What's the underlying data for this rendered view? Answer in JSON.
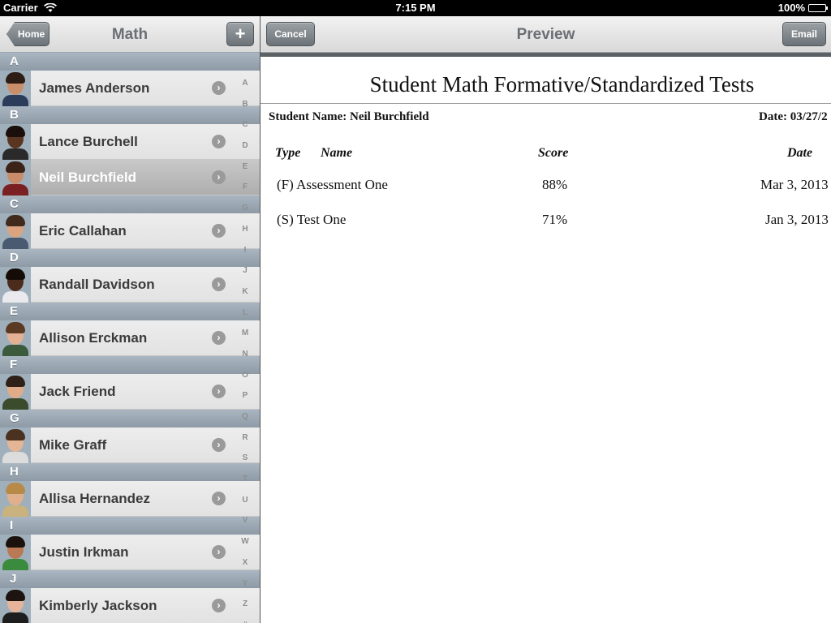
{
  "status_bar": {
    "carrier": "Carrier",
    "time": "7:15 PM",
    "battery": "100%"
  },
  "master": {
    "back_label": "Home",
    "title": "Math",
    "add_label": "+",
    "sections": [
      {
        "letter": "A",
        "students": [
          {
            "name": "James Anderson",
            "skin": "#c98f6a",
            "hair": "#2d1d14",
            "shirt": "#2b3d5a"
          }
        ]
      },
      {
        "letter": "B",
        "students": [
          {
            "name": "Lance Burchell",
            "skin": "#5a3522",
            "hair": "#1a0f0a",
            "shirt": "#2a2a2a"
          },
          {
            "name": "Neil Burchfield",
            "skin": "#c98c6a",
            "hair": "#3b2417",
            "shirt": "#7a1f22",
            "selected": true
          }
        ]
      },
      {
        "letter": "C",
        "students": [
          {
            "name": "Eric Callahan",
            "skin": "#d9a47f",
            "hair": "#3f2a1c",
            "shirt": "#4a5a70"
          }
        ]
      },
      {
        "letter": "D",
        "students": [
          {
            "name": "Randall Davidson",
            "skin": "#4b2c1c",
            "hair": "#160c07",
            "shirt": "#e9e9ee"
          }
        ]
      },
      {
        "letter": "E",
        "students": [
          {
            "name": "Allison Erckman",
            "skin": "#e3b193",
            "hair": "#5a3a23",
            "shirt": "#3c5a3c"
          }
        ]
      },
      {
        "letter": "F",
        "students": [
          {
            "name": "Jack Friend",
            "skin": "#e0ab89",
            "hair": "#2f2118",
            "shirt": "#3a4c2c"
          }
        ]
      },
      {
        "letter": "G",
        "students": [
          {
            "name": "Mike Graff",
            "skin": "#e4b696",
            "hair": "#4b3220",
            "shirt": "#dcdcdc"
          }
        ]
      },
      {
        "letter": "H",
        "students": [
          {
            "name": "Allisa Hernandez",
            "skin": "#e0b08d",
            "hair": "#b88a47",
            "shirt": "#c9b27d"
          }
        ]
      },
      {
        "letter": "I",
        "students": [
          {
            "name": "Justin Irkman",
            "skin": "#b97954",
            "hair": "#1c120d",
            "shirt": "#3a8b3e"
          }
        ]
      },
      {
        "letter": "J",
        "students": [
          {
            "name": "Kimberly Jackson",
            "skin": "#e6b49a",
            "hair": "#1d1410",
            "shirt": "#1d1d1d"
          }
        ]
      }
    ],
    "index_letters": [
      "A",
      "B",
      "C",
      "D",
      "E",
      "F",
      "G",
      "H",
      "I",
      "J",
      "K",
      "L",
      "M",
      "N",
      "O",
      "P",
      "Q",
      "R",
      "S",
      "T",
      "U",
      "V",
      "W",
      "X",
      "Y",
      "Z",
      "#"
    ]
  },
  "detail": {
    "cancel_label": "Cancel",
    "title": "Preview",
    "email_label": "Email",
    "report": {
      "title": "Student Math Formative/Standardized Tests",
      "student_line": "Student Name: Neil Burchfield",
      "date_line": "Date: 03/27/2",
      "headers": {
        "type": "Type",
        "name": "Name",
        "score": "Score",
        "date": "Date"
      },
      "rows": [
        {
          "name": "(F) Assessment One",
          "score": "88%",
          "date": "Mar 3, 2013"
        },
        {
          "name": "(S) Test One",
          "score": "71%",
          "date": "Jan 3, 2013"
        }
      ]
    }
  }
}
